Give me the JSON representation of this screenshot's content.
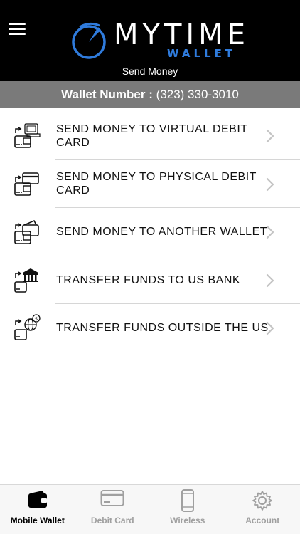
{
  "header": {
    "title": "Send Money",
    "logo_text": "MYTIME",
    "logo_subtext": "WALLET"
  },
  "wallet": {
    "label": "Wallet Number :",
    "number": "(323) 330-3010"
  },
  "menu": {
    "items": [
      {
        "label": "SEND MONEY TO VIRTUAL DEBIT CARD",
        "icon": "virtual-card-icon"
      },
      {
        "label": "SEND MONEY TO PHYSICAL DEBIT CARD",
        "icon": "physical-card-icon"
      },
      {
        "label": "SEND MONEY TO ANOTHER WALLET",
        "icon": "wallet-transfer-icon"
      },
      {
        "label": "TRANSFER FUNDS TO US BANK",
        "icon": "bank-icon"
      },
      {
        "label": "TRANSFER FUNDS OUTSIDE THE US",
        "icon": "globe-dollar-icon"
      }
    ]
  },
  "tabs": [
    {
      "label": "Mobile Wallet",
      "icon": "wallet-icon",
      "active": true
    },
    {
      "label": "Debit Card",
      "icon": "card-icon",
      "active": false
    },
    {
      "label": "Wireless",
      "icon": "phone-icon",
      "active": false
    },
    {
      "label": "Account",
      "icon": "gear-icon",
      "active": false
    }
  ],
  "colors": {
    "header_bg": "#000000",
    "wallet_bar_bg": "#7a7a7a",
    "brand_blue": "#2f7bdc",
    "tab_inactive": "#a0a0a0"
  }
}
